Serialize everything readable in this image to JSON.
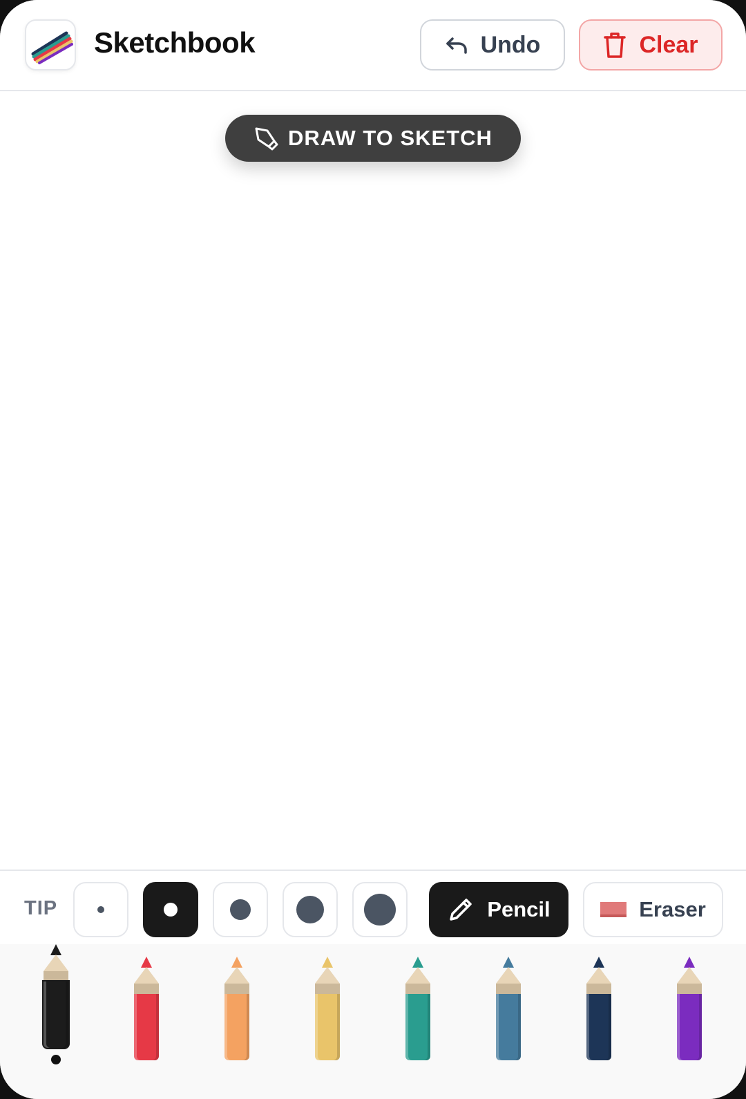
{
  "header": {
    "title": "Sketchbook",
    "undo_label": "Undo",
    "clear_label": "Clear"
  },
  "hint": {
    "label": "DRAW TO SKETCH"
  },
  "toolbar": {
    "tip_label": "TIP",
    "tip_sizes": [
      "xs",
      "sm",
      "md",
      "lg",
      "xl"
    ],
    "selected_tip_index": 1,
    "pencil_label": "Pencil",
    "eraser_label": "Eraser",
    "active_tool": "pencil"
  },
  "palette": {
    "colors": [
      {
        "name": "black",
        "hex": "#1c1c1c"
      },
      {
        "name": "red",
        "hex": "#e63946"
      },
      {
        "name": "orange",
        "hex": "#f4a261"
      },
      {
        "name": "yellow",
        "hex": "#e9c46a"
      },
      {
        "name": "teal",
        "hex": "#2a9d8f"
      },
      {
        "name": "blue",
        "hex": "#457b9d"
      },
      {
        "name": "navy",
        "hex": "#1d3557"
      },
      {
        "name": "purple",
        "hex": "#7b2cbf"
      }
    ],
    "selected_index": 0
  },
  "icons": {
    "app": "colored-pencils-icon",
    "undo": "undo-arrow-icon",
    "clear": "trash-icon",
    "hint": "pen-nib-icon",
    "pencil": "pencil-icon",
    "eraser": "eraser-icon"
  },
  "colors": {
    "accent_danger": "#dc2626",
    "danger_bg": "#fdecec",
    "active_dark": "#1a1a1a",
    "hint_bg": "#3f3f3f"
  }
}
